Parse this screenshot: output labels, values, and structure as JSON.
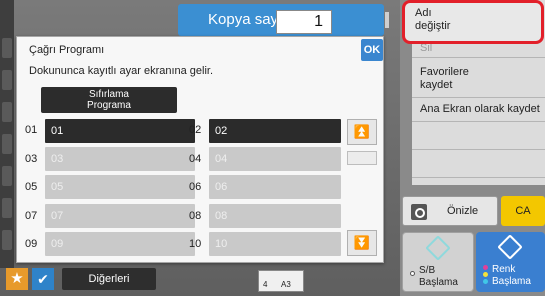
{
  "copy_bar": {
    "label": "Kopya sayısı",
    "count": "1"
  },
  "dialog": {
    "title": "Çağrı Programı",
    "subtitle": "Dokununca kayıtlı ayar ekranına gelir.",
    "ok_label": "OK",
    "reset_label_line1": "Sıfırlama",
    "reset_label_line2": "Programa",
    "programs": [
      {
        "num": "01",
        "label": "01",
        "state": "active"
      },
      {
        "num": "02",
        "label": "02",
        "state": "active"
      },
      {
        "num": "03",
        "label": "03",
        "state": "inactive"
      },
      {
        "num": "04",
        "label": "04",
        "state": "inactive"
      },
      {
        "num": "05",
        "label": "05",
        "state": "inactive"
      },
      {
        "num": "06",
        "label": "06",
        "state": "inactive"
      },
      {
        "num": "07",
        "label": "07",
        "state": "inactive"
      },
      {
        "num": "08",
        "label": "08",
        "state": "inactive"
      },
      {
        "num": "09",
        "label": "09",
        "state": "inactive"
      },
      {
        "num": "10",
        "label": "10",
        "state": "inactive"
      }
    ],
    "scroll_up_icon": "double-chevron-up-icon",
    "scroll_down_icon": "double-chevron-down-icon"
  },
  "right_menu": {
    "rename_line1": "Adı",
    "rename_line2": "değiştir",
    "partial_item": "Sil",
    "favorites_line1": "Favorilere",
    "favorites_line2": "kaydet",
    "home_screen": "Ana Ekran olarak kaydet"
  },
  "actions": {
    "preview": "Önizle",
    "ca": "CA",
    "bw_line1": "S/B",
    "bw_line2": "Başlama",
    "color_line1": "Renk",
    "color_line2": "Başlama"
  },
  "bottom_bar": {
    "others": "Diğerleri",
    "paper_tray": "4",
    "paper_size": "A3"
  },
  "colors": {
    "accent_blue": "#3b8fd2",
    "highlight_red": "#e2202a",
    "ca_yellow": "#f3c700"
  }
}
